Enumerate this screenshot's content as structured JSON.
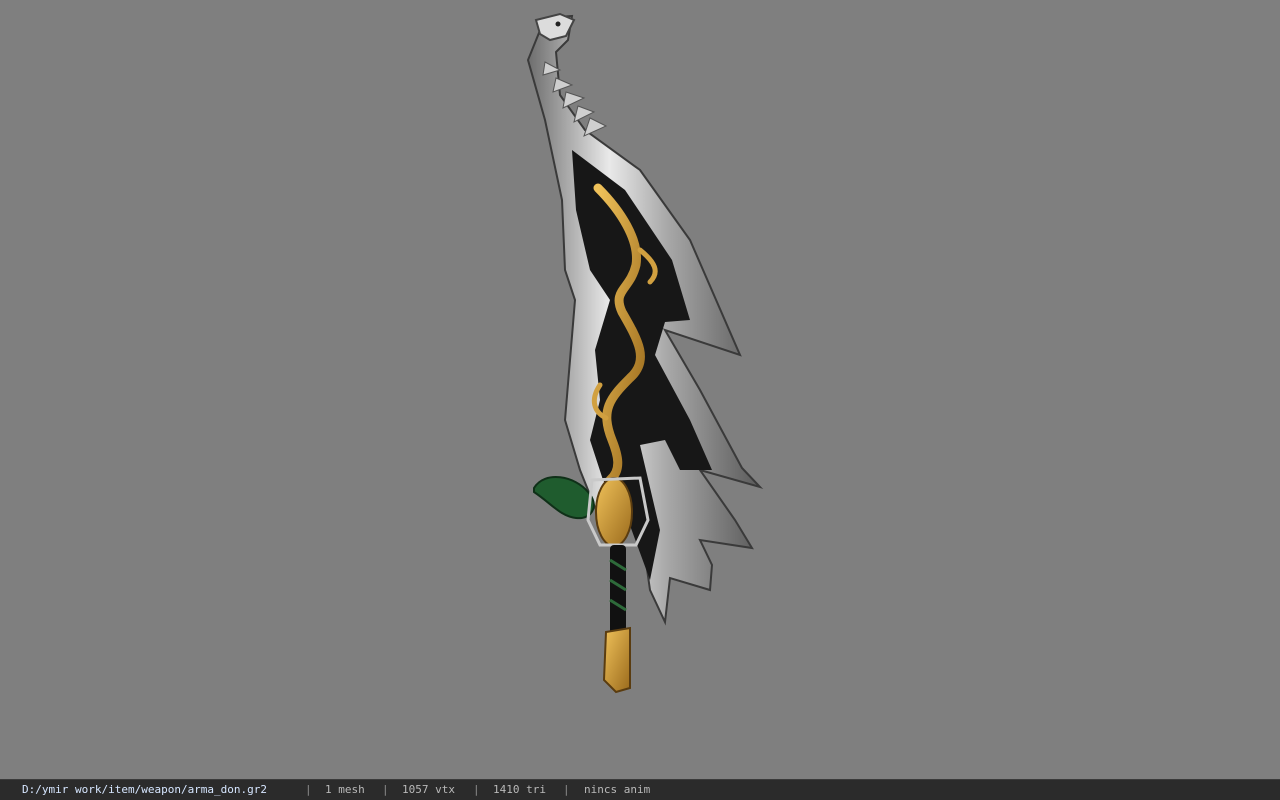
{
  "viewer": {
    "background_color": "#7f7f7f",
    "model_icon": "sword-model-icon"
  },
  "statusbar": {
    "file_path": "D:/ymir work/item/weapon/arma_don.gr2",
    "separator": "|",
    "mesh_count": "1 mesh",
    "vertex_count": "1057 vtx",
    "triangle_count": "1410 tri",
    "animation": "nincs anim"
  }
}
